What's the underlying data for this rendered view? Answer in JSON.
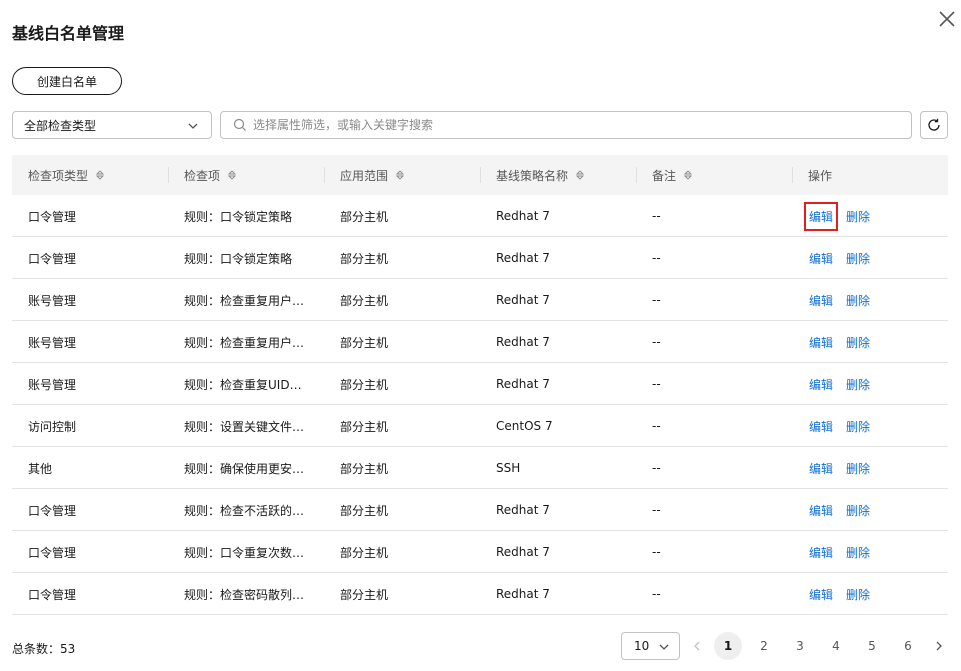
{
  "dialog": {
    "title": "基线白名单管理"
  },
  "toolbar": {
    "create_label": "创建白名单"
  },
  "filter": {
    "type_select_value": "全部检查类型",
    "search_placeholder": "选择属性筛选，或输入关键字搜索"
  },
  "table": {
    "headers": [
      "检查项类型",
      "检查项",
      "应用范围",
      "基线策略名称",
      "备注",
      "操作"
    ],
    "action_edit": "编辑",
    "action_delete": "删除",
    "rows": [
      [
        "口令管理",
        "规则：口令锁定策略",
        "部分主机",
        "Redhat 7",
        "--"
      ],
      [
        "口令管理",
        "规则：口令锁定策略",
        "部分主机",
        "Redhat 7",
        "--"
      ],
      [
        "账号管理",
        "规则：检查重复用户…",
        "部分主机",
        "Redhat 7",
        "--"
      ],
      [
        "账号管理",
        "规则：检查重复用户…",
        "部分主机",
        "Redhat 7",
        "--"
      ],
      [
        "账号管理",
        "规则：检查重复UID…",
        "部分主机",
        "Redhat 7",
        "--"
      ],
      [
        "访问控制",
        "规则：设置关键文件…",
        "部分主机",
        "CentOS 7",
        "--"
      ],
      [
        "其他",
        "规则：确保使用更安…",
        "部分主机",
        "SSH",
        "--"
      ],
      [
        "口令管理",
        "规则：检查不活跃的…",
        "部分主机",
        "Redhat 7",
        "--"
      ],
      [
        "口令管理",
        "规则：口令重复次数…",
        "部分主机",
        "Redhat 7",
        "--"
      ],
      [
        "口令管理",
        "规则：检查密码散列…",
        "部分主机",
        "Redhat 7",
        "--"
      ]
    ]
  },
  "footer": {
    "total_label": "总条数：",
    "total_count": "53",
    "page_size": "10",
    "pages": [
      "1",
      "2",
      "3",
      "4",
      "5",
      "6"
    ],
    "current_page": "1"
  },
  "colors": {
    "link": "#0e6ed8",
    "highlight": "#e02020",
    "header_bg": "#f4f4f4"
  },
  "icons": [
    "close-icon",
    "chevron-down-icon",
    "search-icon",
    "refresh-icon",
    "sort-icon",
    "chevron-left-icon",
    "chevron-right-icon"
  ]
}
